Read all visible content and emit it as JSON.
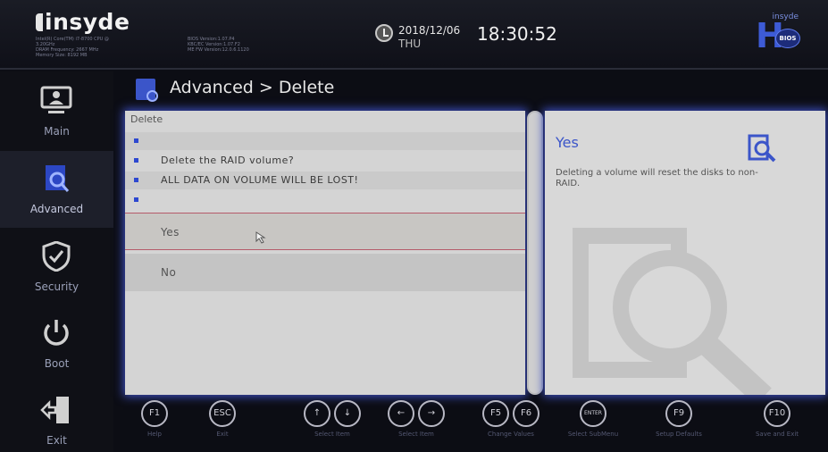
{
  "top_bar": {
    "logo_text": "insyde",
    "sysinfo_left": [
      "Intel(R) Core(TM) i7-8700 CPU @",
      "3.20GHz",
      "DRAM Frequency: 2667 MHz",
      "Memory Size: 8192 MB"
    ],
    "sysinfo_right": [
      "BIOS Version:1.07.P4",
      "KBC/EC Version:1.07.F2",
      "ME FW Version:12.0.6.1120"
    ],
    "date": "2018/12/06",
    "weekday": "THU",
    "time": "18:30:52",
    "hbios_logo_text": "insyde",
    "hbios_badge": "BIOS"
  },
  "sidebar": {
    "items": [
      {
        "label": "Main",
        "icon": "monitor-user-icon"
      },
      {
        "label": "Advanced",
        "icon": "advanced-doc-icon"
      },
      {
        "label": "Security",
        "icon": "shield-check-icon"
      },
      {
        "label": "Boot",
        "icon": "power-icon"
      },
      {
        "label": "Exit",
        "icon": "exit-door-icon"
      }
    ],
    "active": "Advanced"
  },
  "header": {
    "title": "Advanced > Delete"
  },
  "panel": {
    "title": "Delete",
    "rows": [
      "",
      "Delete the RAID volume?",
      "ALL DATA ON VOLUME WILL BE LOST!",
      ""
    ],
    "choices": [
      "Yes",
      "No"
    ],
    "selected": "Yes"
  },
  "help": {
    "title": "Yes",
    "text": "Deleting a volume will reset the disks to non-RAID."
  },
  "keys": [
    {
      "keys": [
        "F1"
      ],
      "label": "Help"
    },
    {
      "keys": [
        "ESC"
      ],
      "label": "Exit"
    },
    {
      "keys": [
        "↑",
        "↓"
      ],
      "label": "Select Item"
    },
    {
      "keys": [
        "←",
        "→"
      ],
      "label": "Select Item"
    },
    {
      "keys": [
        "F5",
        "F6"
      ],
      "label": "Change Values"
    },
    {
      "keys": [
        "ENTER"
      ],
      "label": "Select  SubMenu"
    },
    {
      "keys": [
        "F9"
      ],
      "label": "Setup Defaults"
    },
    {
      "keys": [
        "F10"
      ],
      "label": "Save and Exit"
    }
  ],
  "colors": {
    "accent": "#3b55c9",
    "panel": "#d4d4d4",
    "background": "#0c0d14"
  }
}
